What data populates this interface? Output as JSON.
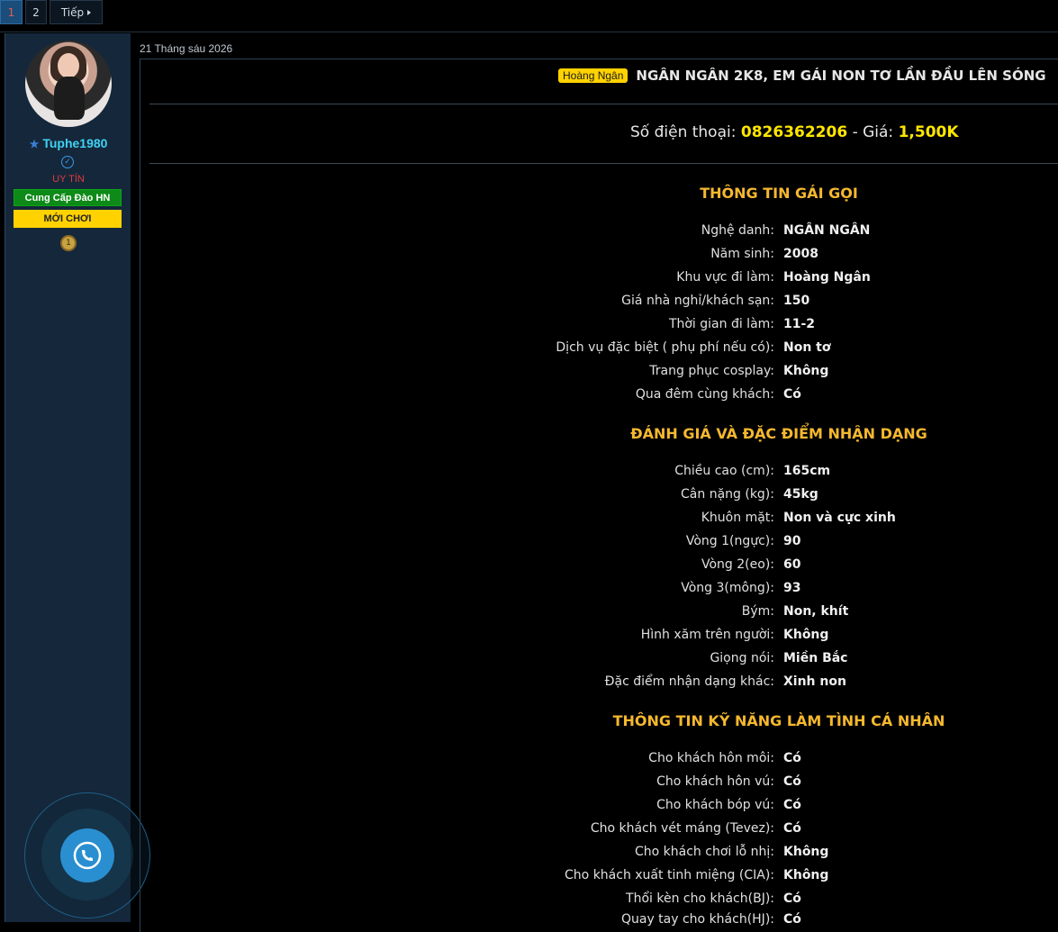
{
  "pagination": {
    "pages": [
      "1",
      "2"
    ],
    "next_label": "Tiếp"
  },
  "sidebar": {
    "username": "Tuphe1980",
    "rank": "UY TÍN",
    "badge_green": "Cung Cấp Đào HN",
    "badge_yellow": "MỚI CHƠI",
    "colors": {
      "username": "#3fd2f5",
      "rank": "#e03b3b",
      "badge_green": "#0d8a17",
      "badge_yellow": "#ffd200"
    }
  },
  "post": {
    "date": "21 Tháng sáu 2026",
    "tag": "Hoàng Ngân",
    "title": "NGÂN NGÂN 2K8, EM GÁI NON TƠ LẦN ĐẦU LÊN SÓNG",
    "phone_label": "Số điện thoại:",
    "phone": "0826362206",
    "price_label": "- Giá:",
    "price": "1,500K"
  },
  "sections": [
    {
      "title": "THÔNG TIN GÁI GỌI",
      "rows": [
        {
          "label": "Nghệ danh:",
          "value": "NGÂN NGÂN"
        },
        {
          "label": "Năm sinh:",
          "value": "2008"
        },
        {
          "label": "Khu vực đi làm:",
          "value": "Hoàng Ngân"
        },
        {
          "label": "Giá nhà nghỉ/khách sạn:",
          "value": "150"
        },
        {
          "label": "Thời gian đi làm:",
          "value": "11-2"
        },
        {
          "label": "Dịch vụ đặc biệt ( phụ phí nếu có):",
          "value": "Non tơ"
        },
        {
          "label": "Trang phục cosplay:",
          "value": "Không"
        },
        {
          "label": "Qua đêm cùng khách:",
          "value": "Có"
        }
      ]
    },
    {
      "title": "ĐÁNH GIÁ VÀ ĐẶC ĐIỂM NHẬN DẠNG",
      "rows": [
        {
          "label": "Chiều cao (cm):",
          "value": "165cm"
        },
        {
          "label": "Cân nặng (kg):",
          "value": "45kg"
        },
        {
          "label": "Khuôn mặt:",
          "value": "Non và cực xinh"
        },
        {
          "label": "Vòng 1(ngực):",
          "value": "90"
        },
        {
          "label": "Vòng 2(eo):",
          "value": "60"
        },
        {
          "label": "Vòng 3(mông):",
          "value": "93"
        },
        {
          "label": "Bým:",
          "value": "Non, khít"
        },
        {
          "label": "Hình xăm trên người:",
          "value": "Không"
        },
        {
          "label": "Giọng nói:",
          "value": "Miền Bắc"
        },
        {
          "label": "Đặc điểm nhận dạng khác:",
          "value": "Xinh non"
        }
      ]
    },
    {
      "title": "THÔNG TIN KỸ NĂNG LÀM TÌNH CÁ NHÂN",
      "rows": [
        {
          "label": "Cho khách hôn môi:",
          "value": "Có"
        },
        {
          "label": "Cho khách hôn vú:",
          "value": "Có"
        },
        {
          "label": "Cho khách bóp vú:",
          "value": "Có"
        },
        {
          "label": "Cho khách vét máng (Tevez):",
          "value": "Có"
        },
        {
          "label": "Cho khách chơi lỗ nhị:",
          "value": "Không"
        },
        {
          "label": "Cho khách xuất tinh miệng (CIA):",
          "value": "Không"
        },
        {
          "label": "Thổi kèn cho khách(BJ):",
          "value": "Có"
        },
        {
          "label": "Quay tay cho khách(HJ):",
          "value": "Có"
        }
      ]
    }
  ],
  "colors": {
    "accent_yellow": "#ffe600",
    "section_title": "#f5b82e",
    "background": "#000000",
    "sidebar_bg": "#15273a"
  }
}
